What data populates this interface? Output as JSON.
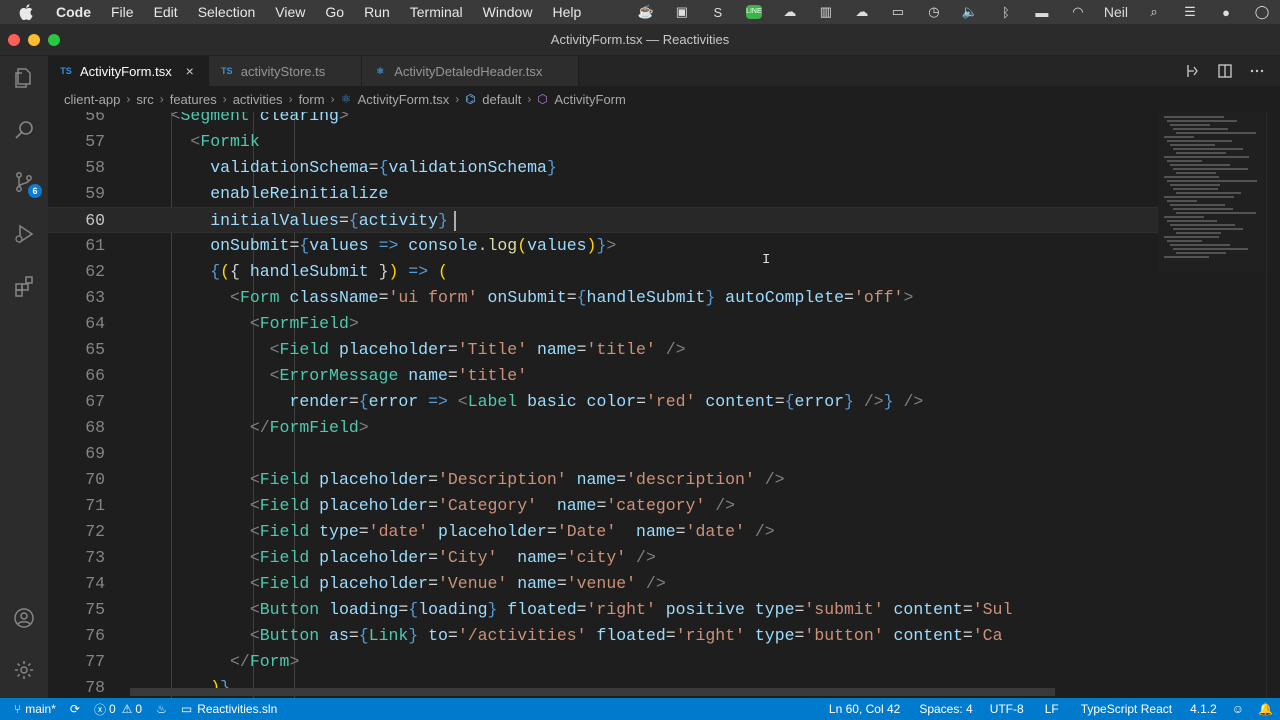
{
  "menubar": {
    "app": "Code",
    "items": [
      "File",
      "Edit",
      "Selection",
      "View",
      "Go",
      "Run",
      "Terminal",
      "Window",
      "Help"
    ],
    "user": "Neil"
  },
  "window": {
    "title": "ActivityForm.tsx — Reactivities"
  },
  "tabs": [
    {
      "label": "ActivityForm.tsx",
      "active": true
    },
    {
      "label": "activityStore.ts",
      "active": false
    },
    {
      "label": "ActivityDetaledHeader.tsx",
      "active": false
    }
  ],
  "tab_icon": "TS",
  "breadcrumb": [
    "client-app",
    "src",
    "features",
    "activities",
    "form",
    "ActivityForm.tsx",
    "default",
    "ActivityForm"
  ],
  "activitybar": {
    "source_control_badge": "6"
  },
  "editor": {
    "lines": [
      {
        "n": "56",
        "cur": false,
        "code": [
          [
            "    ",
            "p"
          ],
          [
            "<",
            "br"
          ],
          [
            "Segment",
            "tag"
          ],
          [
            " clearing",
            "attr"
          ],
          [
            ">",
            "br"
          ]
        ]
      },
      {
        "n": "57",
        "cur": false,
        "code": [
          [
            "      ",
            "p"
          ],
          [
            "<",
            "br"
          ],
          [
            "Formik",
            "tag"
          ]
        ]
      },
      {
        "n": "58",
        "cur": false,
        "code": [
          [
            "        ",
            "p"
          ],
          [
            "validationSchema",
            "attr"
          ],
          [
            "=",
            "p"
          ],
          [
            "{",
            "kw"
          ],
          [
            "validationSchema",
            "var"
          ],
          [
            "}",
            "kw"
          ]
        ]
      },
      {
        "n": "59",
        "cur": false,
        "code": [
          [
            "        ",
            "p"
          ],
          [
            "enableReinitialize",
            "attr"
          ]
        ]
      },
      {
        "n": "60",
        "cur": true,
        "code": [
          [
            "        ",
            "p"
          ],
          [
            "initialValues",
            "attr"
          ],
          [
            "=",
            "p"
          ],
          [
            "{",
            "kw"
          ],
          [
            "activity",
            "var"
          ],
          [
            "}",
            "kw"
          ]
        ]
      },
      {
        "n": "61",
        "cur": false,
        "code": [
          [
            "        ",
            "p"
          ],
          [
            "onSubmit",
            "attr"
          ],
          [
            "=",
            "p"
          ],
          [
            "{",
            "kw"
          ],
          [
            "values",
            "var"
          ],
          [
            " => ",
            "kw"
          ],
          [
            "console",
            "var"
          ],
          [
            ".",
            "p"
          ],
          [
            "log",
            "fn"
          ],
          [
            "(",
            "ft"
          ],
          [
            "values",
            "var"
          ],
          [
            ")",
            "ft"
          ],
          [
            "}",
            "kw"
          ],
          [
            ">",
            "br"
          ]
        ]
      },
      {
        "n": "62",
        "cur": false,
        "code": [
          [
            "        ",
            "p"
          ],
          [
            "{",
            "kw"
          ],
          [
            "(",
            "ft"
          ],
          [
            "{ ",
            "p"
          ],
          [
            "handleSubmit",
            "var"
          ],
          [
            " }",
            "p"
          ],
          [
            ")",
            "ft"
          ],
          [
            " => ",
            "kw"
          ],
          [
            "(",
            "ft"
          ]
        ]
      },
      {
        "n": "63",
        "cur": false,
        "code": [
          [
            "          ",
            "p"
          ],
          [
            "<",
            "br"
          ],
          [
            "Form",
            "tag"
          ],
          [
            " className",
            "attr"
          ],
          [
            "=",
            "p"
          ],
          [
            "'ui form'",
            "str"
          ],
          [
            " onSubmit",
            "attr"
          ],
          [
            "=",
            "p"
          ],
          [
            "{",
            "kw"
          ],
          [
            "handleSubmit",
            "var"
          ],
          [
            "}",
            "kw"
          ],
          [
            " autoComplete",
            "attr"
          ],
          [
            "=",
            "p"
          ],
          [
            "'off'",
            "str"
          ],
          [
            ">",
            "br"
          ]
        ]
      },
      {
        "n": "64",
        "cur": false,
        "code": [
          [
            "            ",
            "p"
          ],
          [
            "<",
            "br"
          ],
          [
            "FormField",
            "tag"
          ],
          [
            ">",
            "br"
          ]
        ]
      },
      {
        "n": "65",
        "cur": false,
        "code": [
          [
            "              ",
            "p"
          ],
          [
            "<",
            "br"
          ],
          [
            "Field",
            "tag"
          ],
          [
            " placeholder",
            "attr"
          ],
          [
            "=",
            "p"
          ],
          [
            "'Title'",
            "str"
          ],
          [
            " name",
            "attr"
          ],
          [
            "=",
            "p"
          ],
          [
            "'title'",
            "str"
          ],
          [
            " />",
            "br"
          ]
        ]
      },
      {
        "n": "66",
        "cur": false,
        "code": [
          [
            "              ",
            "p"
          ],
          [
            "<",
            "br"
          ],
          [
            "ErrorMessage",
            "tag"
          ],
          [
            " name",
            "attr"
          ],
          [
            "=",
            "p"
          ],
          [
            "'title'",
            "str"
          ]
        ]
      },
      {
        "n": "67",
        "cur": false,
        "code": [
          [
            "                ",
            "p"
          ],
          [
            "render",
            "attr"
          ],
          [
            "=",
            "p"
          ],
          [
            "{",
            "kw"
          ],
          [
            "error",
            "var"
          ],
          [
            " => ",
            "kw"
          ],
          [
            "<",
            "br"
          ],
          [
            "Label",
            "tag"
          ],
          [
            " basic",
            "attr"
          ],
          [
            " color",
            "attr"
          ],
          [
            "=",
            "p"
          ],
          [
            "'red'",
            "str"
          ],
          [
            " content",
            "attr"
          ],
          [
            "=",
            "p"
          ],
          [
            "{",
            "kw"
          ],
          [
            "error",
            "var"
          ],
          [
            "}",
            "kw"
          ],
          [
            " />",
            "br"
          ],
          [
            "}",
            "kw"
          ],
          [
            " />",
            "br"
          ]
        ]
      },
      {
        "n": "68",
        "cur": false,
        "code": [
          [
            "            ",
            "p"
          ],
          [
            "</",
            "br"
          ],
          [
            "FormField",
            "tag"
          ],
          [
            ">",
            "br"
          ]
        ]
      },
      {
        "n": "69",
        "cur": false,
        "code": []
      },
      {
        "n": "70",
        "cur": false,
        "code": [
          [
            "            ",
            "p"
          ],
          [
            "<",
            "br"
          ],
          [
            "Field",
            "tag"
          ],
          [
            " placeholder",
            "attr"
          ],
          [
            "=",
            "p"
          ],
          [
            "'Description'",
            "str"
          ],
          [
            " name",
            "attr"
          ],
          [
            "=",
            "p"
          ],
          [
            "'description'",
            "str"
          ],
          [
            " />",
            "br"
          ]
        ]
      },
      {
        "n": "71",
        "cur": false,
        "code": [
          [
            "            ",
            "p"
          ],
          [
            "<",
            "br"
          ],
          [
            "Field",
            "tag"
          ],
          [
            " placeholder",
            "attr"
          ],
          [
            "=",
            "p"
          ],
          [
            "'Category'",
            "str"
          ],
          [
            "  name",
            "attr"
          ],
          [
            "=",
            "p"
          ],
          [
            "'category'",
            "str"
          ],
          [
            " />",
            "br"
          ]
        ]
      },
      {
        "n": "72",
        "cur": false,
        "code": [
          [
            "            ",
            "p"
          ],
          [
            "<",
            "br"
          ],
          [
            "Field",
            "tag"
          ],
          [
            " type",
            "attr"
          ],
          [
            "=",
            "p"
          ],
          [
            "'date'",
            "str"
          ],
          [
            " placeholder",
            "attr"
          ],
          [
            "=",
            "p"
          ],
          [
            "'Date'",
            "str"
          ],
          [
            "  name",
            "attr"
          ],
          [
            "=",
            "p"
          ],
          [
            "'date'",
            "str"
          ],
          [
            " />",
            "br"
          ]
        ]
      },
      {
        "n": "73",
        "cur": false,
        "code": [
          [
            "            ",
            "p"
          ],
          [
            "<",
            "br"
          ],
          [
            "Field",
            "tag"
          ],
          [
            " placeholder",
            "attr"
          ],
          [
            "=",
            "p"
          ],
          [
            "'City'",
            "str"
          ],
          [
            "  name",
            "attr"
          ],
          [
            "=",
            "p"
          ],
          [
            "'city'",
            "str"
          ],
          [
            " />",
            "br"
          ]
        ]
      },
      {
        "n": "74",
        "cur": false,
        "code": [
          [
            "            ",
            "p"
          ],
          [
            "<",
            "br"
          ],
          [
            "Field",
            "tag"
          ],
          [
            " placeholder",
            "attr"
          ],
          [
            "=",
            "p"
          ],
          [
            "'Venue'",
            "str"
          ],
          [
            " name",
            "attr"
          ],
          [
            "=",
            "p"
          ],
          [
            "'venue'",
            "str"
          ],
          [
            " />",
            "br"
          ]
        ]
      },
      {
        "n": "75",
        "cur": false,
        "code": [
          [
            "            ",
            "p"
          ],
          [
            "<",
            "br"
          ],
          [
            "Button",
            "tag"
          ],
          [
            " loading",
            "attr"
          ],
          [
            "=",
            "p"
          ],
          [
            "{",
            "kw"
          ],
          [
            "loading",
            "var"
          ],
          [
            "}",
            "kw"
          ],
          [
            " floated",
            "attr"
          ],
          [
            "=",
            "p"
          ],
          [
            "'right'",
            "str"
          ],
          [
            " positive",
            "attr"
          ],
          [
            " type",
            "attr"
          ],
          [
            "=",
            "p"
          ],
          [
            "'submit'",
            "str"
          ],
          [
            " content",
            "attr"
          ],
          [
            "=",
            "p"
          ],
          [
            "'Sul",
            "str"
          ]
        ]
      },
      {
        "n": "76",
        "cur": false,
        "code": [
          [
            "            ",
            "p"
          ],
          [
            "<",
            "br"
          ],
          [
            "Button",
            "tag"
          ],
          [
            " as",
            "attr"
          ],
          [
            "=",
            "p"
          ],
          [
            "{",
            "kw"
          ],
          [
            "Link",
            "tag"
          ],
          [
            "}",
            "kw"
          ],
          [
            " to",
            "attr"
          ],
          [
            "=",
            "p"
          ],
          [
            "'/activities'",
            "str"
          ],
          [
            " floated",
            "attr"
          ],
          [
            "=",
            "p"
          ],
          [
            "'right'",
            "str"
          ],
          [
            " type",
            "attr"
          ],
          [
            "=",
            "p"
          ],
          [
            "'button'",
            "str"
          ],
          [
            " content",
            "attr"
          ],
          [
            "=",
            "p"
          ],
          [
            "'Ca",
            "str"
          ]
        ]
      },
      {
        "n": "77",
        "cur": false,
        "code": [
          [
            "          ",
            "p"
          ],
          [
            "</",
            "br"
          ],
          [
            "Form",
            "tag"
          ],
          [
            ">",
            "br"
          ]
        ]
      },
      {
        "n": "78",
        "cur": false,
        "code": [
          [
            "        ",
            "p"
          ],
          [
            ")",
            "ft"
          ],
          [
            "}",
            "kw"
          ]
        ]
      }
    ]
  },
  "statusbar": {
    "branch": "main*",
    "errors": "0",
    "warnings": "0",
    "solution": "Reactivities.sln",
    "position": "Ln 60, Col 42",
    "spaces": "Spaces: 4",
    "encoding": "UTF-8",
    "eol": "LF",
    "language": "TypeScript React",
    "version": "4.1.2"
  },
  "colors": {
    "status": "#007acc",
    "tag": "#4ec9b0",
    "attr": "#9cdcfe",
    "string": "#ce9178"
  }
}
